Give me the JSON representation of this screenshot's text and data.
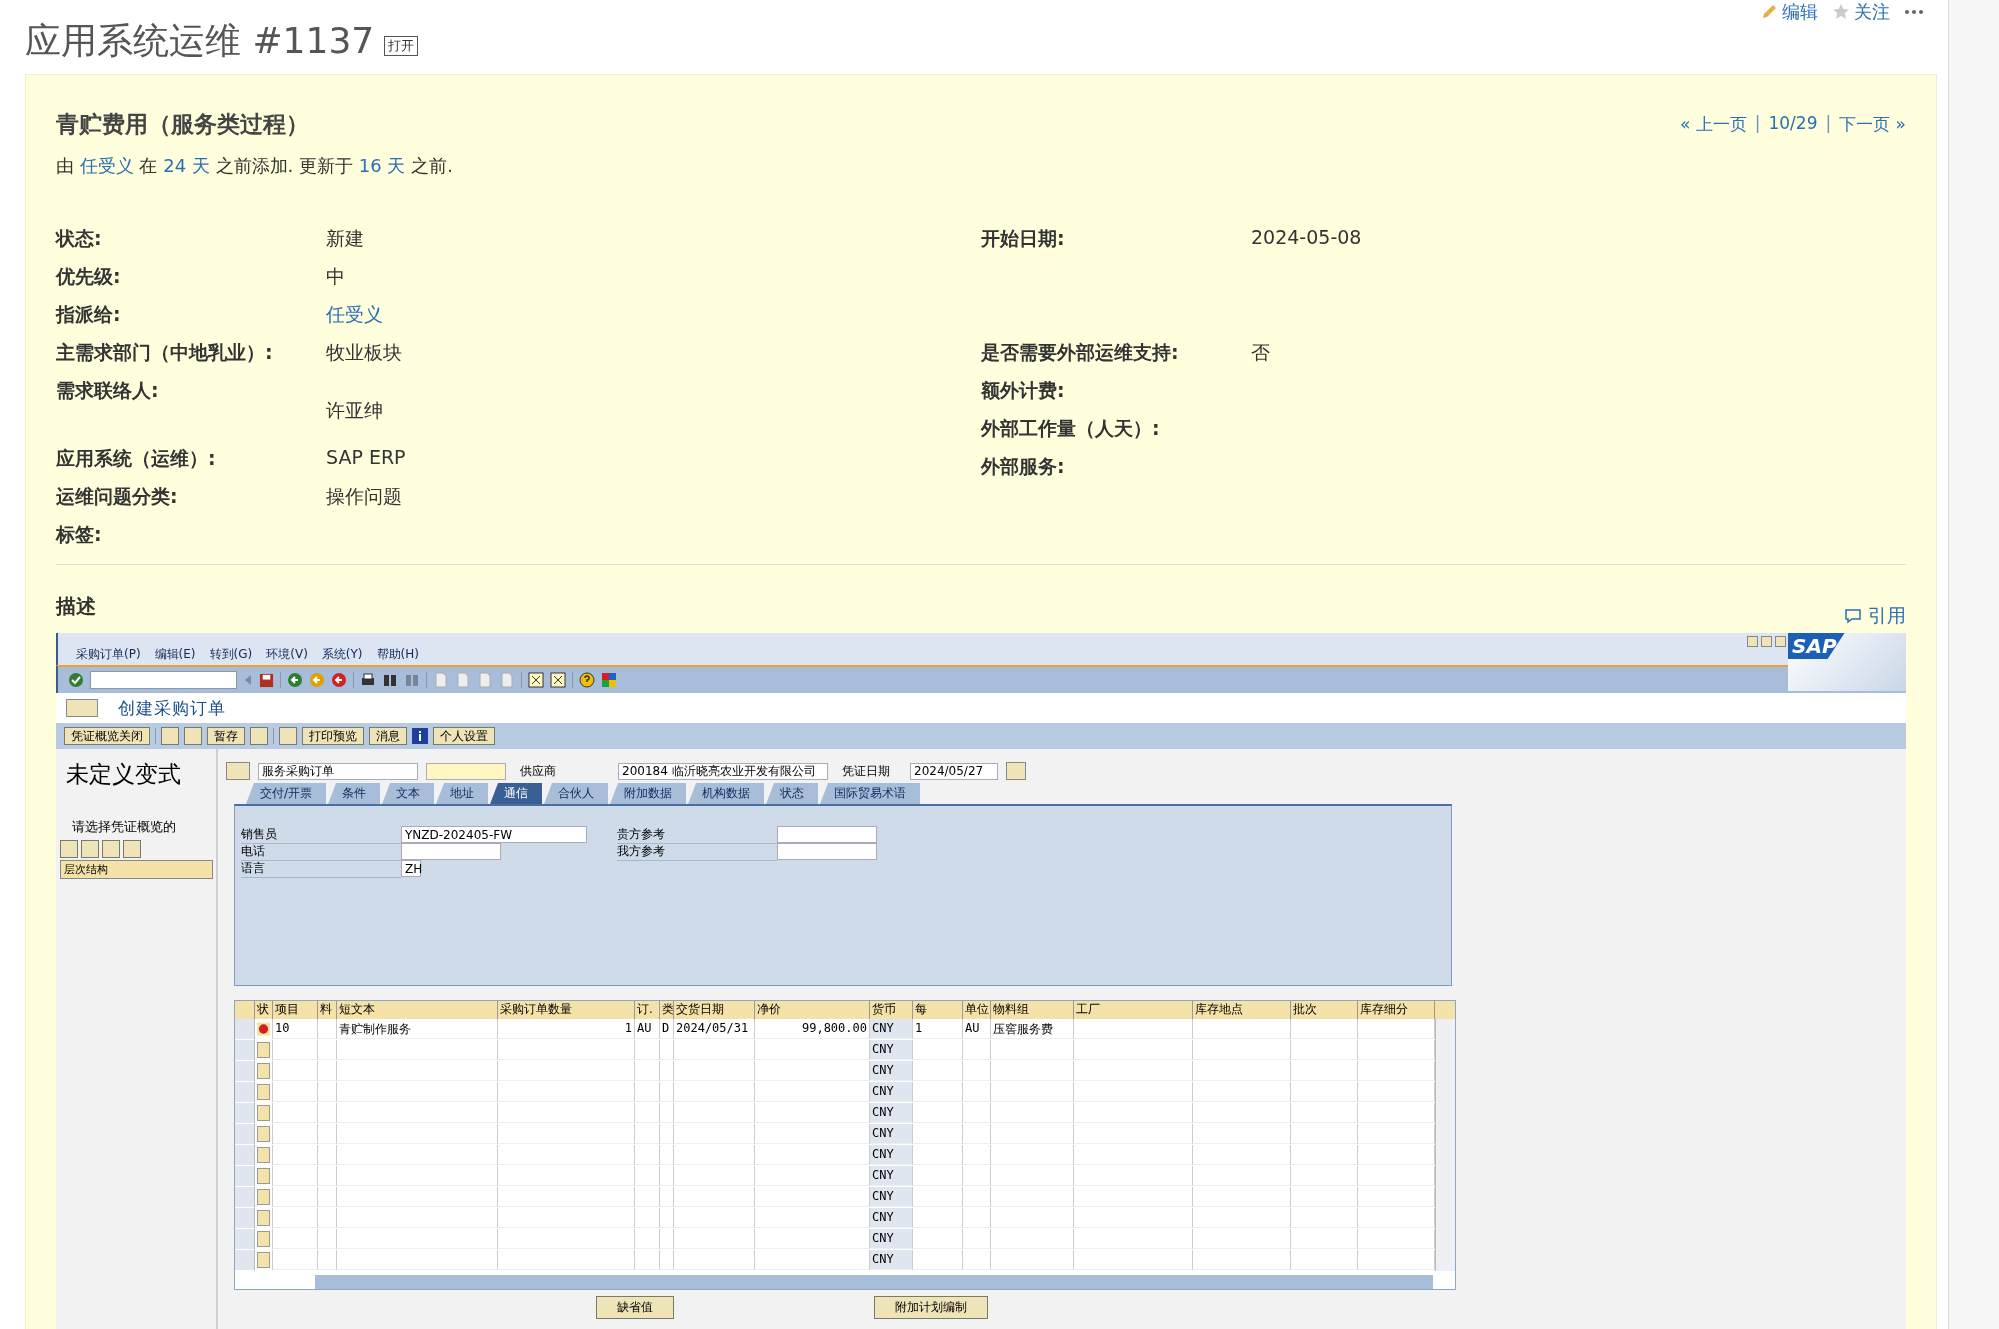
{
  "header": {
    "title": "应用系统运维 #1137",
    "badge": "打开",
    "actions": [
      {
        "kind": "edit",
        "label": "编辑"
      },
      {
        "kind": "watch",
        "label": "关注"
      },
      {
        "kind": "more"
      }
    ]
  },
  "issue": {
    "subject": "青贮费用（服务类过程）",
    "nav": [
      {
        "kind": "link",
        "text": "« 上一页"
      },
      {
        "kind": "sep",
        "text": "|"
      },
      {
        "kind": "link",
        "text": "10/29"
      },
      {
        "kind": "sep",
        "text": "|"
      },
      {
        "kind": "link",
        "text": "下一页 »"
      }
    ],
    "byline": [
      {
        "kind": "text",
        "text": "由"
      },
      {
        "kind": "link",
        "text": "任受义"
      },
      {
        "kind": "text",
        "text": "在"
      },
      {
        "kind": "link",
        "text": "24 天"
      },
      {
        "kind": "text",
        "text": "之前添加. 更新于"
      },
      {
        "kind": "link",
        "text": "16 天"
      },
      {
        "kind": "text",
        "text": "之前."
      }
    ],
    "left": [
      {
        "label": "状态:",
        "value": "新建",
        "kind": "text"
      },
      {
        "label": "优先级:",
        "value": "中",
        "kind": "text"
      },
      {
        "label": "指派给:",
        "value": "任受义",
        "kind": "link"
      },
      {
        "label": "主需求部门（中地乳业）:",
        "value": "牧业板块",
        "kind": "text"
      },
      {
        "label": "需求联络人:",
        "value": "许亚绅",
        "kind": "below"
      },
      {
        "label": "应用系统（运维）:",
        "value": "SAP ERP",
        "kind": "text"
      },
      {
        "label": "运维问题分类:",
        "value": "操作问题",
        "kind": "text"
      },
      {
        "label": "标签:"
      }
    ],
    "right_top": [
      {
        "label": "开始日期:",
        "value": "2024-05-08",
        "kind": "text"
      }
    ],
    "right_custom": [
      {
        "label": "是否需要外部运维支持:",
        "value": "否",
        "kind": "text"
      },
      {
        "label": "额外计费:"
      },
      {
        "label": "外部工作量（人天）:"
      },
      {
        "label": "外部服务:"
      }
    ],
    "description": {
      "title": "描述",
      "quote": "引用"
    }
  },
  "sap": {
    "menu": [
      "采购订单(P)",
      "编辑(E)",
      "转到(G)",
      "环境(V)",
      "系统(Y)",
      "帮助(H)"
    ],
    "logo": "SAP",
    "toolbar": [
      {
        "kind": "check"
      },
      {
        "kind": "field"
      },
      {
        "kind": "back"
      },
      {
        "kind": "save"
      },
      {
        "kind": "sep"
      },
      {
        "kind": "green"
      },
      {
        "kind": "orange"
      },
      {
        "kind": "red"
      },
      {
        "kind": "sep"
      },
      {
        "kind": "print"
      },
      {
        "kind": "find"
      },
      {
        "kind": "find2"
      },
      {
        "kind": "sep"
      },
      {
        "kind": "page"
      },
      {
        "kind": "page"
      },
      {
        "kind": "page"
      },
      {
        "kind": "page"
      },
      {
        "kind": "sep"
      },
      {
        "kind": "grid"
      },
      {
        "kind": "grid"
      },
      {
        "kind": "sep"
      },
      {
        "kind": "help"
      },
      {
        "kind": "color"
      }
    ],
    "title": "创建采购订单",
    "app_buttons": [
      {
        "kind": "text",
        "label": "凭证概览关闭"
      },
      {
        "kind": "sep"
      },
      {
        "kind": "icon"
      },
      {
        "kind": "icon"
      },
      {
        "kind": "text",
        "label": "暂存"
      },
      {
        "kind": "icon"
      },
      {
        "kind": "sep"
      },
      {
        "kind": "icon"
      },
      {
        "kind": "text",
        "label": "打印预览"
      },
      {
        "kind": "text",
        "label": "消息"
      },
      {
        "kind": "info"
      },
      {
        "kind": "text",
        "label": "个人设置"
      }
    ],
    "left_panel": {
      "variant": "未定义变式",
      "prompt": "请选择凭证概览的",
      "tree_item": "层次结构"
    },
    "doc_type": "服务采购订单",
    "vendor_label": "供应商",
    "vendor": "200184 临沂晓亮农业开发有限公司",
    "date_label": "凭证日期",
    "date": "2024/05/27",
    "tabs": [
      {
        "label": "交付/开票",
        "selected": false
      },
      {
        "label": "条件",
        "selected": false
      },
      {
        "label": "文本",
        "selected": false
      },
      {
        "label": "地址",
        "selected": false
      },
      {
        "label": "通信",
        "selected": true
      },
      {
        "label": "合伙人",
        "selected": false
      },
      {
        "label": "附加数据",
        "selected": false
      },
      {
        "label": "机构数据",
        "selected": false
      },
      {
        "label": "状态",
        "selected": false
      },
      {
        "label": "国际贸易术语",
        "selected": false
      }
    ],
    "fields_left": [
      {
        "label": "销售员",
        "value": "YNZD-202405-FW"
      },
      {
        "label": "电话"
      },
      {
        "label": "语言",
        "value": "ZH"
      }
    ],
    "fields_right": [
      {
        "label": "贵方参考"
      },
      {
        "label": "我方参考"
      }
    ],
    "columns": [
      {
        "label": "状"
      },
      {
        "label": "项目"
      },
      {
        "label": "料"
      },
      {
        "label": "短文本"
      },
      {
        "label": "采购订单数量",
        "numeric": true
      },
      {
        "label": "订."
      },
      {
        "label": "类"
      },
      {
        "label": "交货日期"
      },
      {
        "label": "净价",
        "numeric": true
      },
      {
        "label": "货币",
        "readonly": true
      },
      {
        "label": "每"
      },
      {
        "label": "单位"
      },
      {
        "label": "物料组"
      },
      {
        "label": "工厂"
      },
      {
        "label": "库存地点"
      },
      {
        "label": "批次"
      },
      {
        "label": "库存细分"
      }
    ],
    "rows": [
      {
        "error": true,
        "item": "10",
        "cells": [
          "青贮制作服务",
          "1",
          "AU",
          "D",
          "2024/05/31",
          "99,800.00",
          "CNY",
          "1",
          "AU",
          "压窖服务费"
        ]
      },
      {
        "currency": "CNY"
      },
      {
        "currency": "CNY"
      },
      {
        "currency": "CNY"
      },
      {
        "currency": "CNY"
      },
      {
        "currency": "CNY"
      },
      {
        "currency": "CNY"
      },
      {
        "currency": "CNY"
      },
      {
        "currency": "CNY"
      },
      {
        "currency": "CNY"
      },
      {
        "currency": "CNY"
      },
      {
        "currency": "CNY"
      }
    ],
    "bottom_buttons": [
      "缺省值",
      "附加计划编制"
    ]
  }
}
